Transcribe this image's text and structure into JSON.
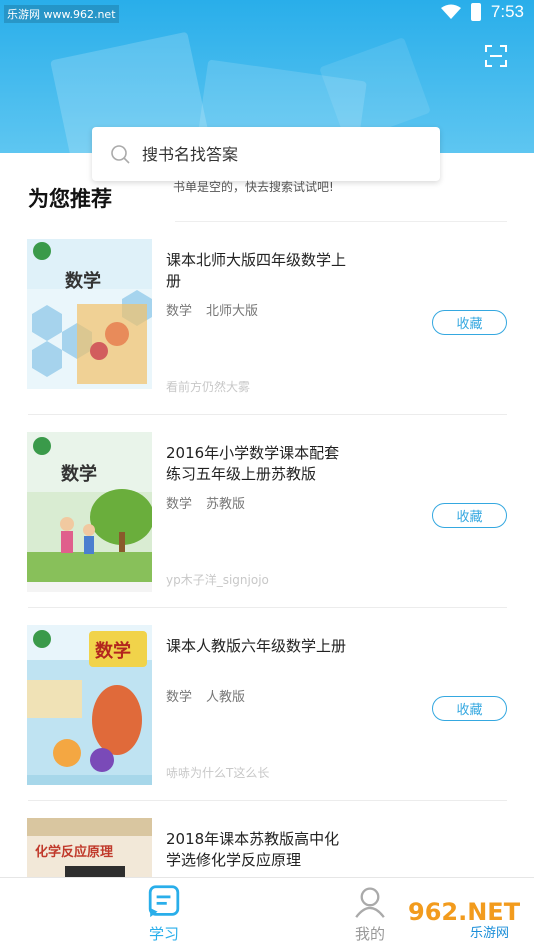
{
  "status_bar": {
    "site": "乐游网 www.962.net",
    "time": "7:53"
  },
  "search": {
    "placeholder": "搜书名找答案",
    "empty_hint": "书单是空的，快去搜索试试吧!"
  },
  "section_title": "为您推荐",
  "books": [
    {
      "title": "课本北师大版四年级数学上册",
      "tags": [
        "数学",
        "北师大版"
      ],
      "user": "看前方仍然大雾",
      "fav_label": "收藏",
      "cover_label": "数学"
    },
    {
      "title": "2016年小学数学课本配套练习五年级上册苏教版",
      "tags": [
        "数学",
        "苏教版"
      ],
      "user": "yp木子洋_signjojo",
      "fav_label": "收藏",
      "cover_label": "数学"
    },
    {
      "title": "课本人教版六年级数学上册",
      "tags": [
        "数学",
        "人教版"
      ],
      "user": "哧哧为什么T这么长",
      "fav_label": "收藏",
      "cover_label": "数学"
    },
    {
      "title": "2018年课本苏教版高中化学选修化学反应原理",
      "tags": [],
      "user": "",
      "fav_label": "",
      "cover_label": "化学反应原理"
    }
  ],
  "tabbar": {
    "study_label": "学习",
    "mine_label": "我的"
  },
  "watermark": {
    "text": "962.NET",
    "sub": "乐游网"
  },
  "colors": {
    "accent": "#29aeea",
    "header_top": "#29aeea",
    "button_border": "#35a8e0"
  },
  "icons": {
    "scan": "scan-icon",
    "search": "search-icon",
    "study_tab": "study-tab-icon",
    "mine_tab": "user-icon",
    "wifi": "wifi-icon",
    "battery": "battery-icon"
  }
}
